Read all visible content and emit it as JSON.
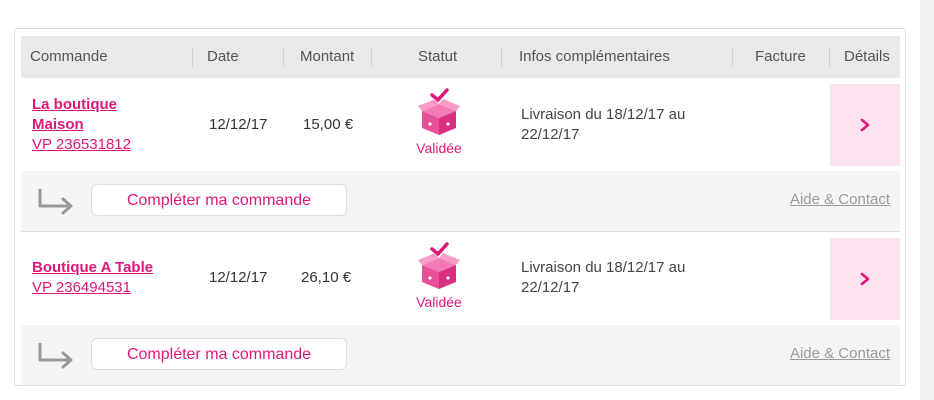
{
  "table": {
    "headers": {
      "commande": "Commande",
      "date": "Date",
      "montant": "Montant",
      "statut": "Statut",
      "infos": "Infos complémentaires",
      "facture": "Facture",
      "details": "Détails"
    }
  },
  "orders": [
    {
      "shop_line1": "La boutique",
      "shop_line2": "Maison",
      "ref": "VP 236531812",
      "date": "12/12/17",
      "amount": "15,00 €",
      "status": "Validée",
      "info_line1": "Livraison du 18/12/17 au",
      "info_line2": "22/12/17",
      "complete_label": "Compléter ma commande",
      "help_label": "Aide & Contact"
    },
    {
      "shop_line1": "Boutique A Table",
      "ref": "VP 236494531",
      "date": "12/12/17",
      "amount": "26,10 €",
      "status": "Validée",
      "info_line1": "Livraison du 18/12/17 au",
      "info_line2": "22/12/17",
      "complete_label": "Compléter ma commande",
      "help_label": "Aide & Contact"
    }
  ],
  "colors": {
    "accent": "#e0177a",
    "details_bg": "#fce3f0",
    "header_bg": "#e9e9e9",
    "footer_bg": "#f5f5f5"
  },
  "icons": {
    "status": "pink-box-check-icon",
    "details": "chevron-right-icon",
    "continue": "return-arrow-icon"
  }
}
